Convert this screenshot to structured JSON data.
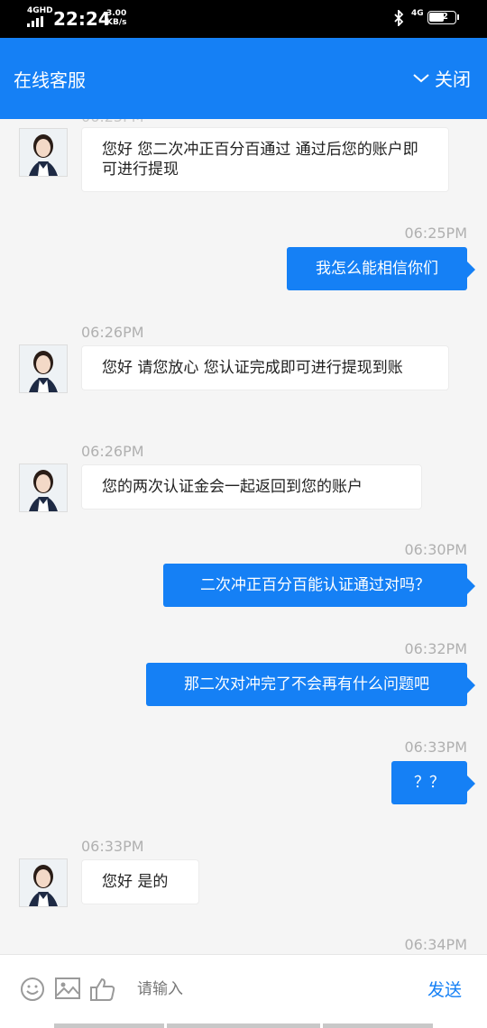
{
  "status_bar": {
    "network": "4GHD",
    "time": "22:24",
    "speed_value": "3.00",
    "speed_unit": "KB/s",
    "network_right": "4G",
    "battery": "62"
  },
  "header": {
    "title": "在线客服",
    "close_label": "关闭"
  },
  "messages": [
    {
      "from": "agent",
      "text": "您好 您二次冲正百分百通过 通过后您的账户即可进行提现"
    },
    {
      "from": "user",
      "time": "06:25PM",
      "text": "我怎么能相信你们"
    },
    {
      "from": "agent",
      "time": "06:26PM",
      "text": "您好 请您放心 您认证完成即可进行提现到账"
    },
    {
      "from": "agent",
      "time": "06:26PM",
      "text": "您的两次认证金会一起返回到您的账户"
    },
    {
      "from": "user",
      "time": "06:30PM",
      "text": "二次冲正百分百能认证通过对吗？"
    },
    {
      "from": "user",
      "time": "06:32PM",
      "text": "那二次对冲完了不会再有什么问题吧"
    },
    {
      "from": "user",
      "time": "06:33PM",
      "text": "？？"
    },
    {
      "from": "agent",
      "time": "06:33PM",
      "text": "您好 是的"
    },
    {
      "from": "user",
      "time": "06:34PM"
    }
  ],
  "input_bar": {
    "placeholder": "请输入",
    "send_label": "发送",
    "icons": [
      "emoji-icon",
      "image-icon",
      "thumbs-up-icon"
    ]
  },
  "colors": {
    "accent": "#1580f5",
    "background": "#f5f5f5"
  }
}
